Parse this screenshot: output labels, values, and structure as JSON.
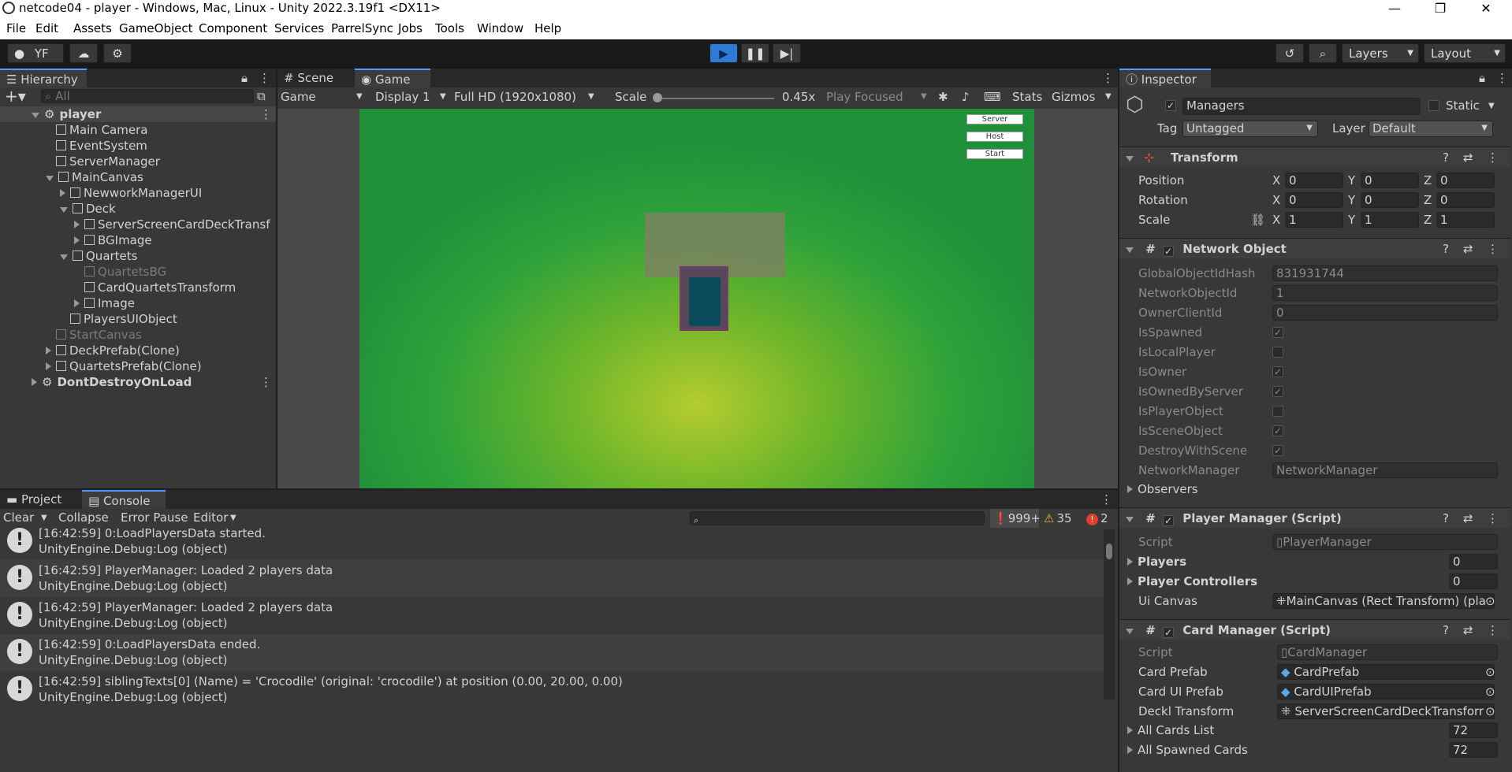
{
  "window": {
    "title": "netcode04 - player - Windows, Mac, Linux - Unity 2022.3.19f1 <DX11>",
    "minimize": "—",
    "maximize": "❐",
    "close": "✕"
  },
  "menu": [
    "File",
    "Edit",
    "Assets",
    "GameObject",
    "Component",
    "Services",
    "ParrelSync",
    "Jobs",
    "Tools",
    "Window",
    "Help"
  ],
  "toolbar": {
    "account": "YF",
    "layers": "Layers",
    "layout": "Layout"
  },
  "hierarchy": {
    "tab": "Hierarchy",
    "search_placeholder": "All",
    "rows": [
      {
        "label": "player",
        "indent": 0,
        "expand": "open",
        "kind": "scene",
        "dim": false
      },
      {
        "label": "Main Camera",
        "indent": 1,
        "expand": "none",
        "kind": "obj",
        "dim": false
      },
      {
        "label": "EventSystem",
        "indent": 1,
        "expand": "none",
        "kind": "obj",
        "dim": false
      },
      {
        "label": "ServerManager",
        "indent": 1,
        "expand": "none",
        "kind": "obj",
        "dim": false
      },
      {
        "label": "MainCanvas",
        "indent": 1,
        "expand": "open",
        "kind": "obj",
        "dim": false
      },
      {
        "label": "NewworkManagerUI",
        "indent": 2,
        "expand": "closed",
        "kind": "obj",
        "dim": false
      },
      {
        "label": "Deck",
        "indent": 2,
        "expand": "open",
        "kind": "obj",
        "dim": false
      },
      {
        "label": "ServerScreenCardDeckTransf",
        "indent": 3,
        "expand": "closed",
        "kind": "obj",
        "dim": false
      },
      {
        "label": "BGImage",
        "indent": 3,
        "expand": "closed",
        "kind": "obj",
        "dim": false
      },
      {
        "label": "Quartets",
        "indent": 2,
        "expand": "open",
        "kind": "obj",
        "dim": false
      },
      {
        "label": "QuartetsBG",
        "indent": 3,
        "expand": "none",
        "kind": "obj",
        "dim": true
      },
      {
        "label": "CardQuartetsTransform",
        "indent": 3,
        "expand": "none",
        "kind": "obj",
        "dim": false
      },
      {
        "label": "Image",
        "indent": 3,
        "expand": "closed",
        "kind": "obj",
        "dim": false
      },
      {
        "label": "PlayersUIObject",
        "indent": 2,
        "expand": "none",
        "kind": "obj",
        "dim": false
      },
      {
        "label": "StartCanvas",
        "indent": 1,
        "expand": "none",
        "kind": "obj",
        "dim": true
      },
      {
        "label": "DeckPrefab(Clone)",
        "indent": 1,
        "expand": "closed",
        "kind": "obj",
        "dim": false
      },
      {
        "label": "QuartetsPrefab(Clone)",
        "indent": 1,
        "expand": "closed",
        "kind": "obj",
        "dim": false
      },
      {
        "label": "DontDestroyOnLoad",
        "indent": 0,
        "expand": "closed",
        "kind": "scene",
        "dim": false
      }
    ]
  },
  "scene_tabs": {
    "scene": "Scene",
    "game": "Game"
  },
  "game_bar": {
    "mode": "Game",
    "display": "Display 1",
    "resolution": "Full HD (1920x1080)",
    "scale_label": "Scale",
    "scale_value": "0.45x",
    "play_focused": "Play Focused",
    "stats": "Stats",
    "gizmos": "Gizmos"
  },
  "game_view": {
    "buttons": [
      "Server",
      "Host",
      "Start"
    ]
  },
  "bottom_tabs": {
    "project": "Project",
    "console": "Console"
  },
  "console": {
    "clear": "Clear",
    "collapse": "Collapse",
    "error_pause": "Error Pause",
    "editor": "Editor",
    "log_count": "999+",
    "warn_count": "35",
    "error_count": "2",
    "entries": [
      {
        "l1": "[16:42:59] 0:LoadPlayersData started.",
        "l2": "UnityEngine.Debug:Log (object)"
      },
      {
        "l1": "[16:42:59] PlayerManager: Loaded 2 players data",
        "l2": "UnityEngine.Debug:Log (object)"
      },
      {
        "l1": "[16:42:59] PlayerManager: Loaded 2 players data",
        "l2": "UnityEngine.Debug:Log (object)"
      },
      {
        "l1": "[16:42:59] 0:LoadPlayersData ended.",
        "l2": "UnityEngine.Debug:Log (object)"
      },
      {
        "l1": "[16:42:59] siblingTexts[0] (Name) = 'Crocodile' (original: 'crocodile') at position (0.00, 20.00, 0.00)",
        "l2": "UnityEngine.Debug:Log (object)"
      }
    ]
  },
  "inspector": {
    "tab": "Inspector",
    "object_name": "Managers",
    "static": "Static",
    "tag_label": "Tag",
    "tag_value": "Untagged",
    "layer_label": "Layer",
    "layer_value": "Default",
    "transform": {
      "title": "Transform",
      "position": {
        "label": "Position",
        "x": "0",
        "y": "0",
        "z": "0"
      },
      "rotation": {
        "label": "Rotation",
        "x": "0",
        "y": "0",
        "z": "0"
      },
      "scale": {
        "label": "Scale",
        "x": "1",
        "y": "1",
        "z": "1"
      }
    },
    "network_object": {
      "title": "Network Object",
      "fields": [
        {
          "label": "GlobalObjectIdHash",
          "value": "831931744",
          "type": "text"
        },
        {
          "label": "NetworkObjectId",
          "value": "1",
          "type": "text"
        },
        {
          "label": "OwnerClientId",
          "value": "0",
          "type": "text"
        },
        {
          "label": "IsSpawned",
          "value": "✓",
          "type": "check"
        },
        {
          "label": "IsLocalPlayer",
          "value": "",
          "type": "check"
        },
        {
          "label": "IsOwner",
          "value": "✓",
          "type": "check"
        },
        {
          "label": "IsOwnedByServer",
          "value": "✓",
          "type": "check"
        },
        {
          "label": "IsPlayerObject",
          "value": "",
          "type": "check"
        },
        {
          "label": "IsSceneObject",
          "value": "✓",
          "type": "check"
        },
        {
          "label": "DestroyWithScene",
          "value": "✓",
          "type": "check"
        },
        {
          "label": "NetworkManager",
          "value": "NetworkManager",
          "type": "text"
        }
      ],
      "observers": "Observers"
    },
    "player_manager": {
      "title": "Player Manager (Script)",
      "script_label": "Script",
      "script_value": "PlayerManager",
      "players_label": "Players",
      "players_value": "0",
      "controllers_label": "Player Controllers",
      "controllers_value": "0",
      "canvas_label": "Ui Canvas",
      "canvas_value": "MainCanvas (Rect Transform) (pla"
    },
    "card_manager": {
      "title": "Card Manager (Script)",
      "script_label": "Script",
      "script_value": "CardManager",
      "card_prefab_label": "Card Prefab",
      "card_prefab_value": "CardPrefab",
      "card_ui_prefab_label": "Card UI Prefab",
      "card_ui_prefab_value": "CardUIPrefab",
      "deck_transform_label": "Deckl Transform",
      "deck_transform_value": "ServerScreenCardDeckTransforr",
      "all_cards_label": "All Cards List",
      "all_cards_value": "72",
      "all_spawned_label": "All Spawned Cards",
      "all_spawned_value": "72"
    }
  }
}
